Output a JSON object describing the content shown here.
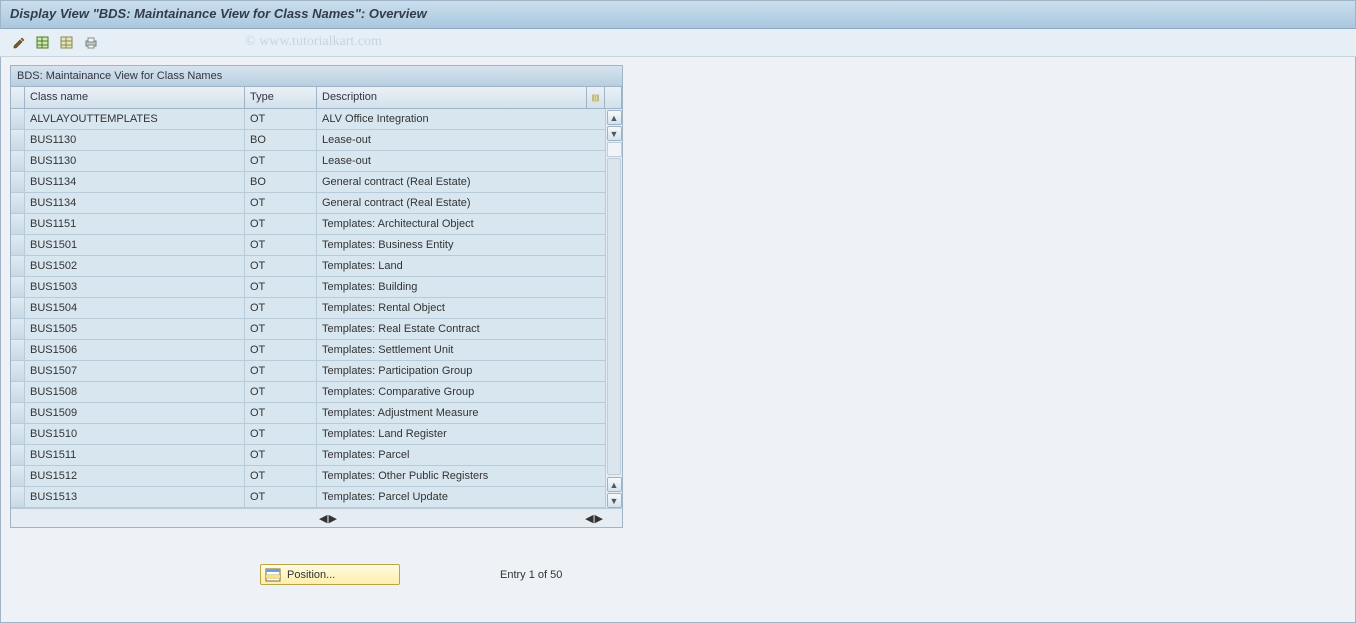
{
  "title": "Display View \"BDS: Maintainance View for Class Names\": Overview",
  "watermark": "© www.tutorialkart.com",
  "panel": {
    "header": "BDS: Maintainance View for Class Names",
    "columns": {
      "name": "Class name",
      "type": "Type",
      "desc": "Description"
    },
    "rows": [
      {
        "name": "ALVLAYOUTTEMPLATES",
        "type": "OT",
        "desc": "ALV Office Integration"
      },
      {
        "name": "BUS1130",
        "type": "BO",
        "desc": "Lease-out"
      },
      {
        "name": "BUS1130",
        "type": "OT",
        "desc": "Lease-out"
      },
      {
        "name": "BUS1134",
        "type": "BO",
        "desc": "General contract (Real Estate)"
      },
      {
        "name": "BUS1134",
        "type": "OT",
        "desc": "General contract (Real Estate)"
      },
      {
        "name": "BUS1151",
        "type": "OT",
        "desc": "Templates: Architectural Object"
      },
      {
        "name": "BUS1501",
        "type": "OT",
        "desc": "Templates: Business Entity"
      },
      {
        "name": "BUS1502",
        "type": "OT",
        "desc": "Templates: Land"
      },
      {
        "name": "BUS1503",
        "type": "OT",
        "desc": "Templates: Building"
      },
      {
        "name": "BUS1504",
        "type": "OT",
        "desc": "Templates: Rental Object"
      },
      {
        "name": "BUS1505",
        "type": "OT",
        "desc": "Templates: Real Estate Contract"
      },
      {
        "name": "BUS1506",
        "type": "OT",
        "desc": "Templates: Settlement Unit"
      },
      {
        "name": "BUS1507",
        "type": "OT",
        "desc": "Templates: Participation Group"
      },
      {
        "name": "BUS1508",
        "type": "OT",
        "desc": "Templates: Comparative Group"
      },
      {
        "name": "BUS1509",
        "type": "OT",
        "desc": "Templates: Adjustment Measure"
      },
      {
        "name": "BUS1510",
        "type": "OT",
        "desc": "Templates: Land Register"
      },
      {
        "name": "BUS1511",
        "type": "OT",
        "desc": "Templates: Parcel"
      },
      {
        "name": "BUS1512",
        "type": "OT",
        "desc": "Templates: Other Public Registers"
      },
      {
        "name": "BUS1513",
        "type": "OT",
        "desc": "Templates: Parcel Update"
      }
    ],
    "config_aria": "Configure columns"
  },
  "footer": {
    "position_label": "Position...",
    "entry_text": "Entry 1 of 50"
  }
}
